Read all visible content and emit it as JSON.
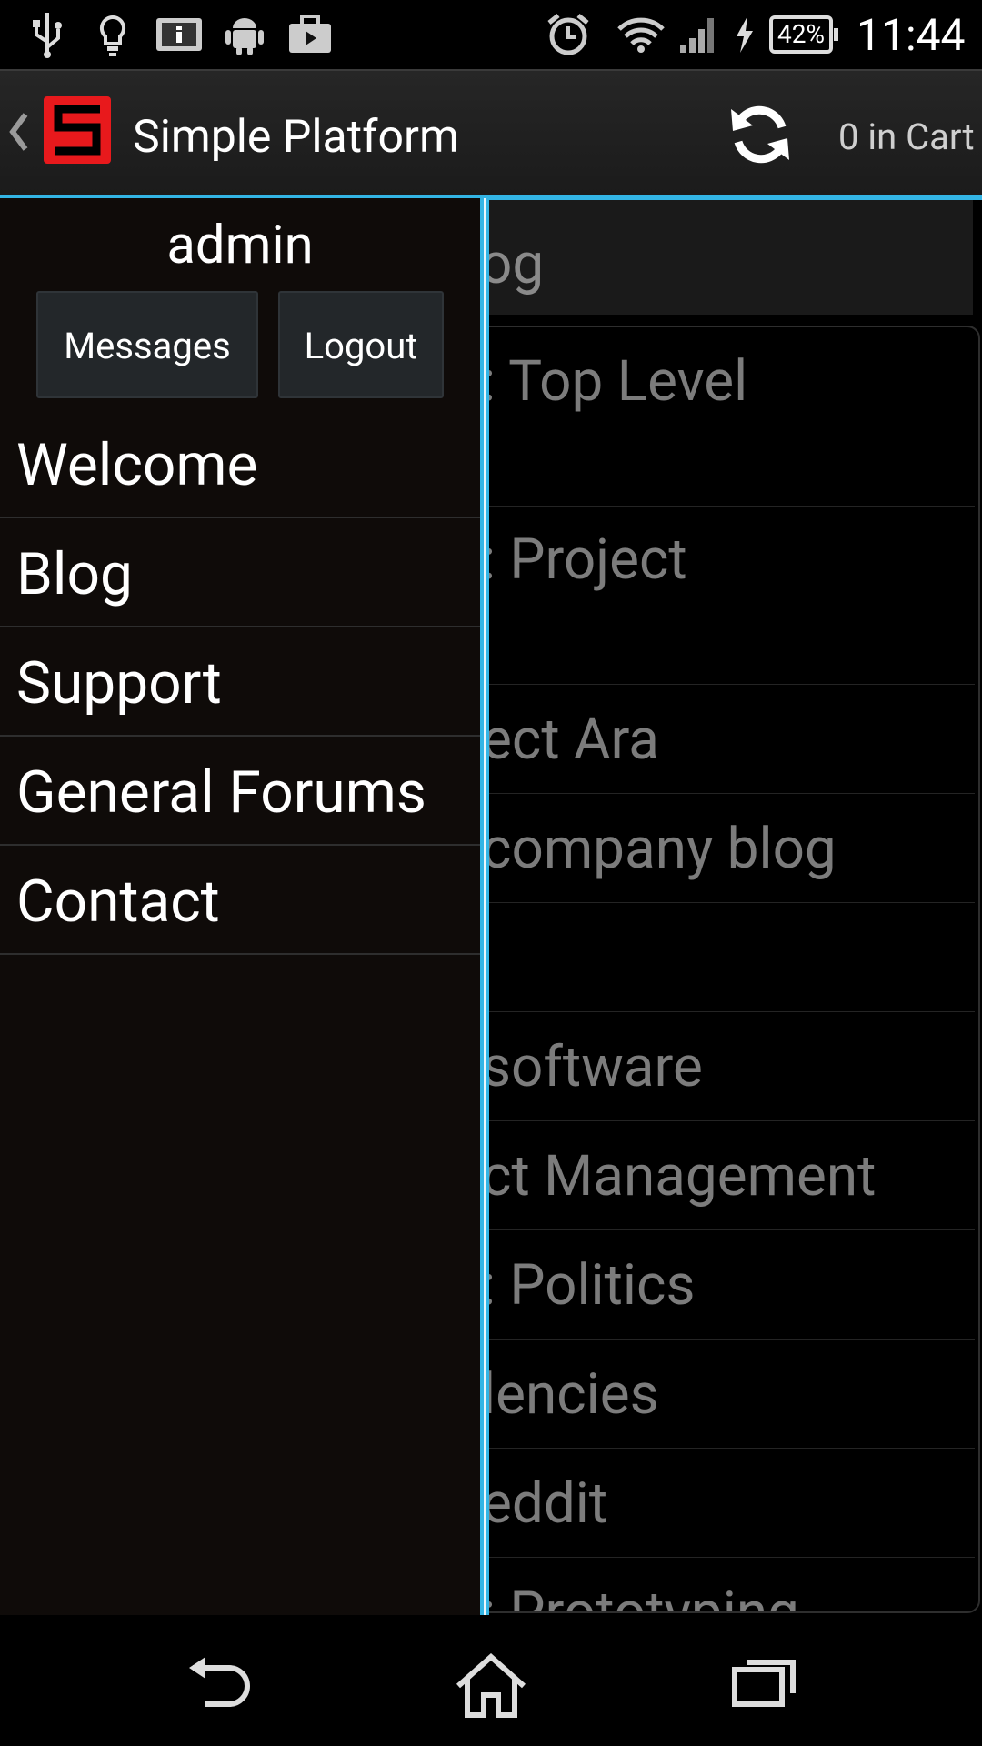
{
  "status_bar": {
    "icons": [
      "usb-icon",
      "bulb-icon",
      "info-icon",
      "android-icon",
      "briefcase-icon",
      "alarm-icon",
      "wifi-icon",
      "signal-icon",
      "charging-icon"
    ],
    "battery": "42%",
    "time": "11:44"
  },
  "action_bar": {
    "title": "Simple Platform",
    "cart": "0 in Cart",
    "accent_color": "#33b5e5",
    "logo_color": "#e8191c"
  },
  "drawer": {
    "username": "admin",
    "messages_label": "Messages",
    "logout_label": "Logout",
    "items": [
      "Welcome",
      "Blog",
      "Support",
      "General Forums",
      "Contact"
    ]
  },
  "content": {
    "header": "og",
    "rows": [
      ": Top Level",
      ": Project",
      "ect Ara",
      "company blog",
      "",
      "software",
      "ct Management",
      ": Politics",
      "lencies",
      "eddit",
      ": Prototyping"
    ]
  },
  "nav_bar": {
    "icons": [
      "back-icon",
      "home-icon",
      "recents-icon"
    ]
  }
}
